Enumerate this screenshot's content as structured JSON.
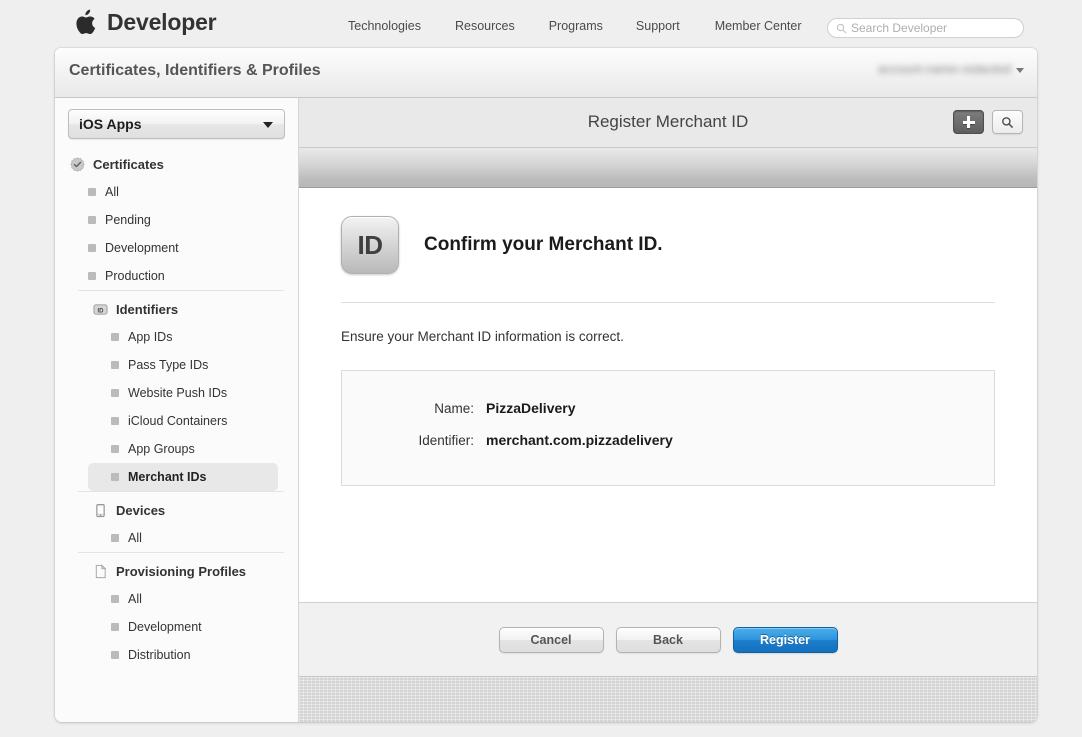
{
  "globalnav": {
    "brand": "Developer",
    "apple_icon": "apple-logo",
    "links": [
      "Technologies",
      "Resources",
      "Programs",
      "Support",
      "Member Center"
    ],
    "search": {
      "placeholder": "Search Developer",
      "value": "",
      "icon": "search-icon"
    }
  },
  "panel": {
    "title": "Certificates, Identifiers & Profiles",
    "account_name": "account-name-redacted",
    "account_caret_icon": "chevron-down-icon"
  },
  "sidebar": {
    "platform_select": {
      "value": "iOS Apps",
      "caret_icon": "chevron-down-icon"
    },
    "groups": [
      {
        "title": "Certificates",
        "icon": "certificate-seal-icon",
        "items": [
          {
            "label": "All",
            "selected": false
          },
          {
            "label": "Pending",
            "selected": false
          },
          {
            "label": "Development",
            "selected": false
          },
          {
            "label": "Production",
            "selected": false
          }
        ]
      },
      {
        "title": "Identifiers",
        "icon": "id-badge-icon",
        "items": [
          {
            "label": "App IDs",
            "selected": false
          },
          {
            "label": "Pass Type IDs",
            "selected": false
          },
          {
            "label": "Website Push IDs",
            "selected": false
          },
          {
            "label": "iCloud Containers",
            "selected": false
          },
          {
            "label": "App Groups",
            "selected": false
          },
          {
            "label": "Merchant IDs",
            "selected": true
          }
        ]
      },
      {
        "title": "Devices",
        "icon": "device-phone-icon",
        "items": [
          {
            "label": "All",
            "selected": false
          }
        ]
      },
      {
        "title": "Provisioning Profiles",
        "icon": "document-icon",
        "items": [
          {
            "label": "All",
            "selected": false
          },
          {
            "label": "Development",
            "selected": false
          },
          {
            "label": "Distribution",
            "selected": false
          }
        ]
      }
    ]
  },
  "content": {
    "header": {
      "title": "Register Merchant ID",
      "add_button_icon": "plus-icon",
      "search_button_icon": "search-icon"
    },
    "confirm": {
      "badge_text": "ID",
      "heading": "Confirm your Merchant ID.",
      "description": "Ensure your Merchant ID information is correct.",
      "fields": [
        {
          "label": "Name:",
          "value": "PizzaDelivery"
        },
        {
          "label": "Identifier:",
          "value": "merchant.com.pizzadelivery"
        }
      ]
    },
    "footer": {
      "cancel_label": "Cancel",
      "back_label": "Back",
      "register_label": "Register"
    }
  },
  "colors": {
    "accent_blue": "#1c7ecb",
    "page_background": "#efefef",
    "panel_background": "#ffffff",
    "sidebar_background": "#fbfbfb",
    "selected_item": "#e8e8e8"
  }
}
